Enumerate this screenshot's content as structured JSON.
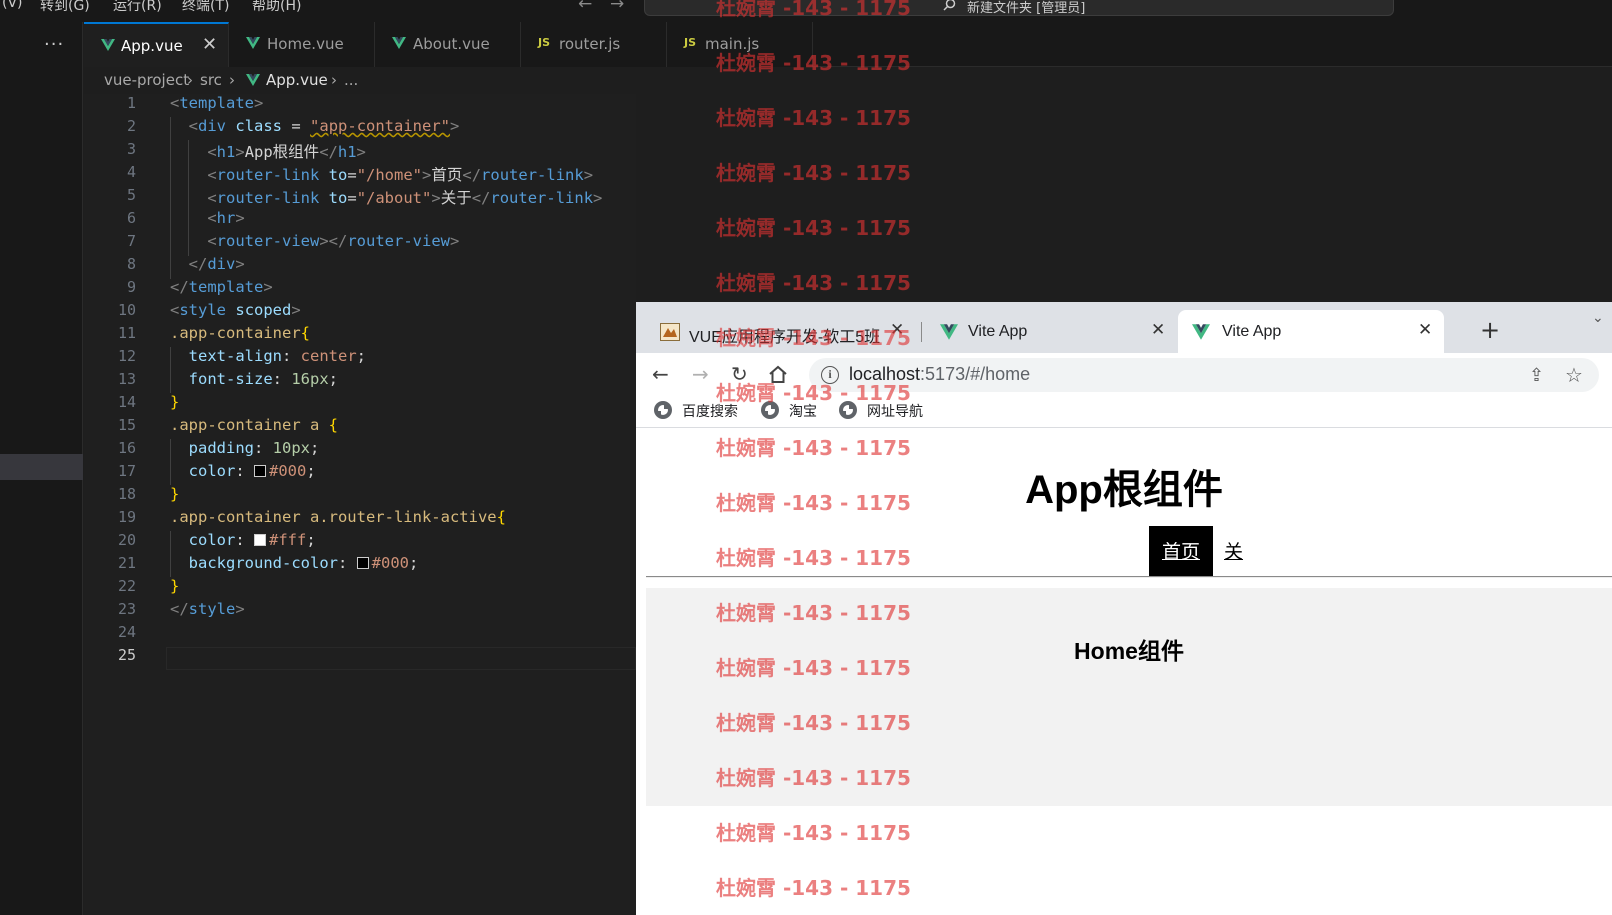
{
  "menubar": {
    "items": [
      "(V)",
      "转到(G)",
      "运行(R)",
      "终端(T)",
      "帮助(H)"
    ],
    "command_center": "新建文件夹 [管理员]"
  },
  "tabs": [
    {
      "label": "App.vue",
      "icon": "vue-icon",
      "active": true
    },
    {
      "label": "Home.vue",
      "icon": "vue-icon"
    },
    {
      "label": "About.vue",
      "icon": "vue-icon"
    },
    {
      "label": "router.js",
      "icon": "js-icon",
      "icon_text": "JS"
    },
    {
      "label": "main.js",
      "icon": "js-icon",
      "icon_text": "JS"
    }
  ],
  "breadcrumb": {
    "project": "vue-project",
    "folder": "src",
    "file": "App.vue",
    "more": "..."
  },
  "editor": {
    "line_numbers": [
      "1",
      "2",
      "3",
      "4",
      "5",
      "6",
      "7",
      "8",
      "9",
      "10",
      "11",
      "12",
      "13",
      "14",
      "15",
      "16",
      "17",
      "18",
      "19",
      "20",
      "21",
      "22",
      "23",
      "24",
      "25"
    ],
    "current_line": "25",
    "code": {
      "l1_tag": "template",
      "l2_tag": "div",
      "l2_attr": "class",
      "l2_eq": " = ",
      "l2_val": "\"app-container\"",
      "l3_tag": "h1",
      "l3_text": "App根组件",
      "l4_tag": "router-link",
      "l4_attr": "to",
      "l4_val": "\"/home\"",
      "l4_text": "首页",
      "l5_tag": "router-link",
      "l5_attr": "to",
      "l5_val": "\"/about\"",
      "l5_text": "关于",
      "l6_tag": "hr",
      "l7_tag": "router-view",
      "l8_tag": "div",
      "l9_tag": "template",
      "l10_tag": "style",
      "l10_attr": "scoped",
      "l11_sel": ".app-container",
      "l12_prop": "text-align",
      "l12_val": "center",
      "l13_prop": "font-size",
      "l13_num": "16px",
      "l15_sel": ".app-container a ",
      "l16_prop": "padding",
      "l16_num": "10px",
      "l17_prop": "color",
      "l17_val": "#000",
      "l19_sel": ".app-container a.router-link-active",
      "l20_prop": "color",
      "l20_val": "#fff",
      "l21_prop": "background-color",
      "l21_val": "#000",
      "l23_tag": "style"
    }
  },
  "browser": {
    "tabs": [
      {
        "label": "VUE应用程序开发-软工5班",
        "active": false
      },
      {
        "label": "Vite App",
        "active": false
      },
      {
        "label": "Vite App",
        "active": true
      }
    ],
    "new_tab": "+",
    "url_host": "localhost",
    "url_path": ":5173/#/home",
    "bookmarks": [
      "百度搜索",
      "淘宝",
      "网址导航"
    ],
    "page": {
      "heading": "App根组件",
      "link_home": "首页",
      "link_about": "关于",
      "view_heading": "Home组件"
    }
  },
  "watermark": {
    "text": "杜婉霄 -143 - 1175"
  },
  "colors": {
    "accent": "#0078d4",
    "vue_green": "#41b883",
    "js_yellow": "#cbcb41",
    "watermark": "#de3232"
  }
}
